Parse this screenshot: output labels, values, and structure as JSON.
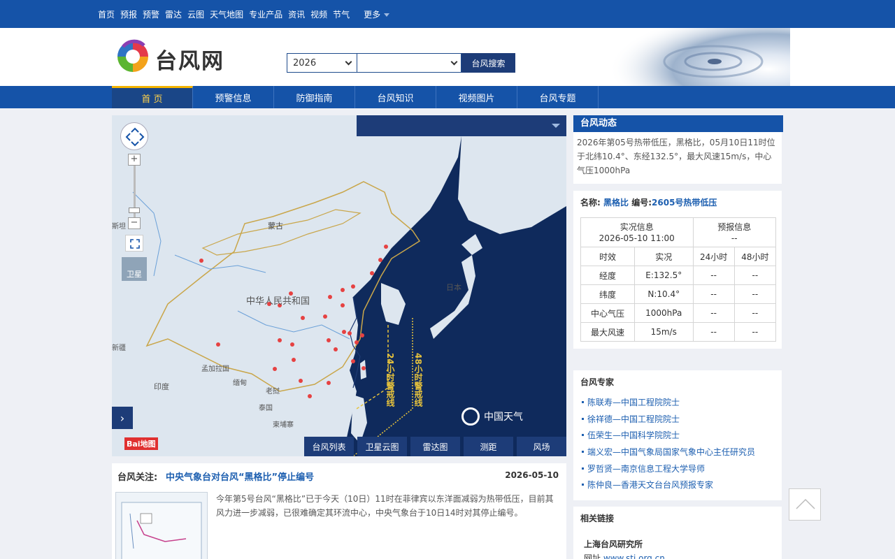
{
  "topnav": {
    "items": [
      "首页",
      "预报",
      "预警",
      "雷达",
      "云图",
      "天气地图",
      "专业产品",
      "资讯",
      "视频",
      "节气"
    ],
    "more": "更多"
  },
  "header": {
    "logo_text": "台风网",
    "year": "2026",
    "typhoon_name": "",
    "search_button": "台风搜索"
  },
  "mainnav": [
    "首 页",
    "预警信息",
    "防御指南",
    "台风知识",
    "视频图片",
    "台风专题"
  ],
  "map": {
    "labels": {
      "mongolia": "蒙古",
      "china": "中华人民共和国",
      "japan": "日本",
      "india": "印度",
      "bangladesh": "孟加拉国",
      "myanmar": "缅甸",
      "laos": "老挝",
      "thailand": "泰国",
      "cambodia": "柬埔寨",
      "kazakh_left": "斯坦",
      "xinjiang_left": "新疆",
      "warn24": "24小时警戒线",
      "warn48": "48小时警戒线"
    },
    "sat_label": "卫星",
    "logo": "中国天气",
    "baidu": "Bai地图",
    "buttons": [
      "台风列表",
      "卫星云图",
      "雷达图",
      "测距",
      "风场"
    ]
  },
  "dynamics": {
    "title": "台风动态",
    "text": "2026年第05号热带低压，黑格比，05月10日11时位于北纬10.4°、东经132.5°，最大风速15m/s，中心气压1000hPa"
  },
  "info": {
    "name_label": "名称:",
    "name": "黑格比",
    "code_label": "编号:",
    "code": "2605号热带低压",
    "obs_title": "实况信息",
    "obs_time": "2026-05-10 11:00",
    "fcst_title": "预报信息",
    "fcst_value": "--",
    "cols": [
      "时效",
      "实况",
      "24小时",
      "48小时"
    ],
    "rows": [
      {
        "label": "经度",
        "values": [
          "E:132.5°",
          "--",
          "--"
        ]
      },
      {
        "label": "纬度",
        "values": [
          "N:10.4°",
          "--",
          "--"
        ]
      },
      {
        "label": "中心气压",
        "values": [
          "1000hPa",
          "--",
          "--"
        ]
      },
      {
        "label": "最大风速",
        "values": [
          "15m/s",
          "--",
          "--"
        ]
      }
    ]
  },
  "experts": {
    "title": "台风专家",
    "list": [
      "陈联寿—中国工程院院士",
      "徐祥德—中国工程院院士",
      "伍荣生—中国科学院院士",
      "端义宏—中国气象局国家气象中心主任研究员",
      "罗哲贤—南京信息工程大学导师",
      "陈仲良—香港天文台台风预报专家"
    ]
  },
  "links": {
    "title": "相关链接",
    "org": "上海台风研究所",
    "url_label": "网址",
    "url": "www.sti.org.cn"
  },
  "news": {
    "label": "台风关注:",
    "headline": "中央气象台对台风“黑格比”停止编号",
    "date": "2026-05-10",
    "body": "今年第5号台风“黑格比”已于今天（10日）11时在菲律宾以东洋面减弱为热带低压，目前其风力进一步减弱，已很难确定其环流中心，中央气象台于10日14时对其停止编号。"
  }
}
